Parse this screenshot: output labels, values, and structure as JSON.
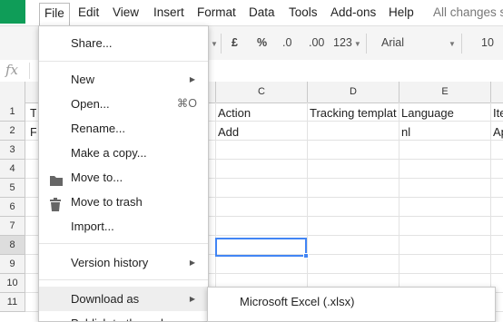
{
  "menubar": {
    "items": [
      "File",
      "Edit",
      "View",
      "Insert",
      "Format",
      "Data",
      "Tools",
      "Add-ons",
      "Help"
    ],
    "status": "All changes s"
  },
  "toolbar": {
    "currency": "£",
    "percent": "%",
    "dec_decrease": ".0",
    "dec_increase": ".00",
    "more_formats": "123",
    "font": "Arial",
    "font_size": "10"
  },
  "formula_bar": {
    "fx": "fx"
  },
  "grid": {
    "columns": [
      "C",
      "D",
      "E"
    ],
    "rows": [
      "1",
      "2",
      "3",
      "4",
      "5",
      "6",
      "7",
      "8",
      "9",
      "10",
      "11"
    ],
    "selected_row": "8",
    "row1": [
      "Action",
      "Tracking templat",
      "Language",
      "Ite"
    ],
    "row2": [
      "Add",
      "",
      "nl",
      "Ap"
    ],
    "left_fragments": [
      "T",
      "F"
    ]
  },
  "file_menu": {
    "share": "Share...",
    "new": "New",
    "open": "Open...",
    "open_shortcut": "⌘O",
    "rename": "Rename...",
    "copy": "Make a copy...",
    "move": "Move to...",
    "trash": "Move to trash",
    "import": "Import...",
    "version": "Version history",
    "download": "Download as",
    "publish": "Publish to the web..."
  },
  "download_submenu": {
    "xlsx": "Microsoft Excel (.xlsx)"
  },
  "colors": {
    "accent": "#4285f4",
    "logo": "#0f9d58"
  }
}
